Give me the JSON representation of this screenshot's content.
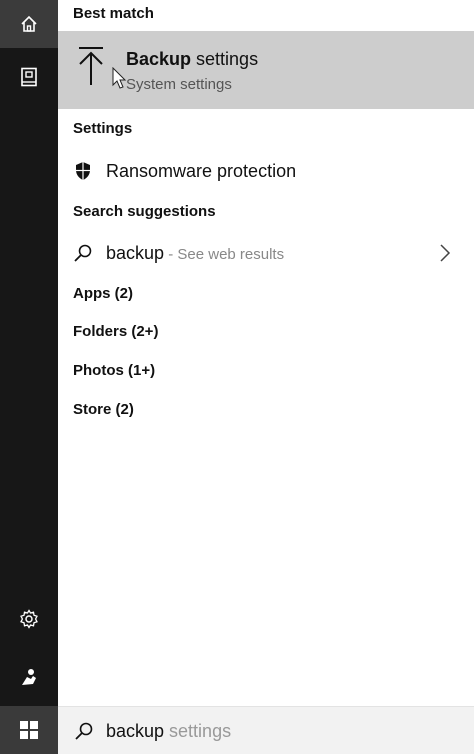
{
  "rail": {
    "icons": [
      "home-icon",
      "documents-icon",
      "settings-gear-icon",
      "person-icon"
    ]
  },
  "panel": {
    "best_match_header": "Best match",
    "best_match": {
      "title_bold": "Backup",
      "title_rest": " settings",
      "subtitle": "System settings",
      "icon": "upload-arrow-icon"
    },
    "settings_header": "Settings",
    "settings_item": {
      "label": "Ransomware protection",
      "icon": "shield-icon"
    },
    "suggestions_header": "Search suggestions",
    "suggestion": {
      "query": "backup",
      "hint": " - See web results",
      "icon": "search-icon"
    },
    "categories": [
      "Apps (2)",
      "Folders (2+)",
      "Photos (1+)",
      "Store (2)"
    ]
  },
  "taskbar": {
    "search_typed": "backup",
    "search_completion": " settings",
    "start_icon": "windows-logo-icon"
  }
}
